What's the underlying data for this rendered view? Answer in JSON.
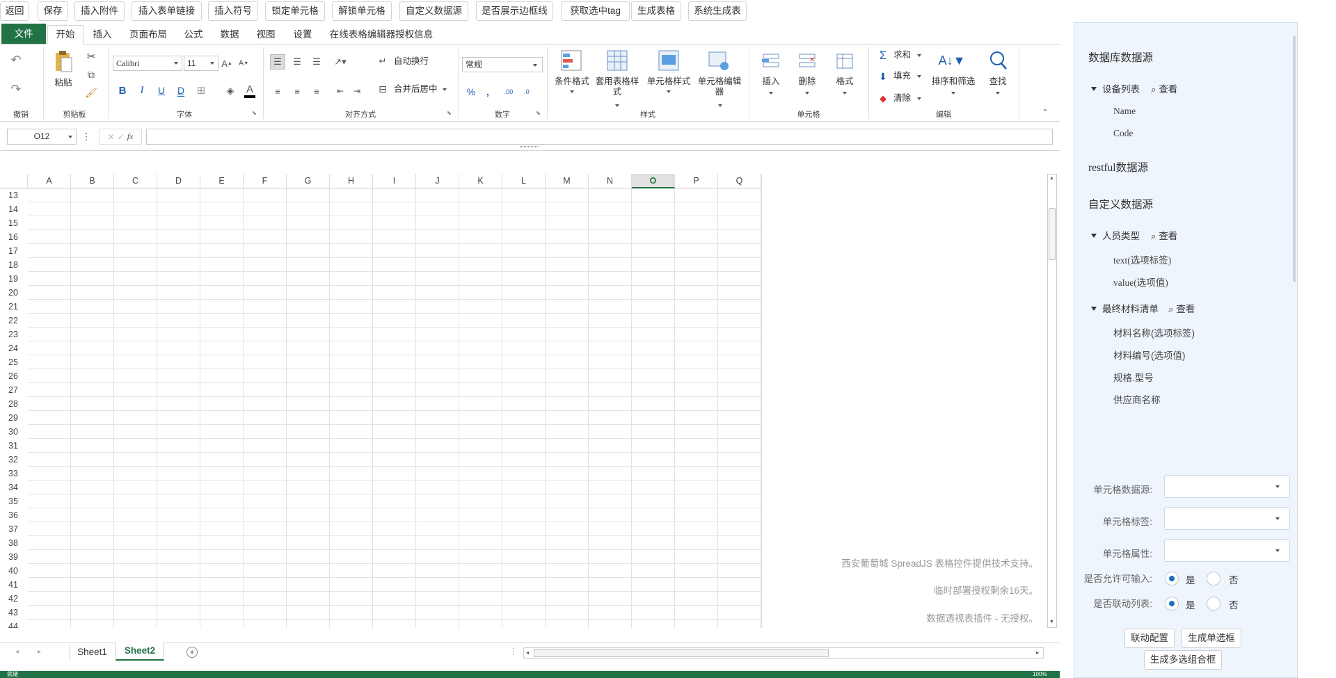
{
  "toolbar": {
    "buttons": [
      "返回",
      "保存",
      "插入附件",
      "插入表单链接",
      "插入符号",
      "锁定单元格",
      "解锁单元格",
      "自定义数据源",
      "是否展示边框线",
      "获取选中tag",
      "生成表格",
      "系统生成表"
    ]
  },
  "ribbon": {
    "tabs": [
      "文件",
      "开始",
      "插入",
      "页面布局",
      "公式",
      "数据",
      "视图",
      "设置",
      "在线表格编辑器授权信息"
    ],
    "active_tab": "开始",
    "groups": {
      "undo": "撤销",
      "clipboard": "剪贴板",
      "font": "字体",
      "alignment": "对齐方式",
      "number": "数字",
      "style": "样式",
      "cells": "单元格",
      "edit": "编辑"
    },
    "paste": "粘贴",
    "font_name": "Calibri",
    "font_size": "11",
    "wrap_text": "自动换行",
    "merge_center": "合并后居中",
    "number_format": "常规",
    "cond_format": "条件格式",
    "table_style": "套用表格样式",
    "cell_style": "单元格样式",
    "cell_editor": "单元格编辑器",
    "insert": "插入",
    "delete": "删除",
    "format": "格式",
    "sum": "求和",
    "fill": "填充",
    "clear": "清除",
    "sort_filter": "排序和筛选",
    "find": "查找"
  },
  "formula_bar": {
    "name_box": "O12",
    "formula": ""
  },
  "grid": {
    "columns": [
      "A",
      "B",
      "C",
      "D",
      "E",
      "F",
      "G",
      "H",
      "I",
      "J",
      "K",
      "L",
      "M",
      "N",
      "O",
      "P",
      "Q"
    ],
    "selected_column": "O",
    "rows": [
      "13",
      "14",
      "15",
      "16",
      "17",
      "18",
      "19",
      "20",
      "21",
      "22",
      "23",
      "24",
      "25",
      "26",
      "27",
      "28",
      "29",
      "30",
      "31",
      "32",
      "33",
      "34",
      "35",
      "36",
      "37",
      "38",
      "39",
      "40",
      "41",
      "42",
      "43",
      "44"
    ]
  },
  "watermark": {
    "line1": "西安葡萄城 SpreadJS 表格控件提供技术支持。",
    "line2": "临时部署授权剩余16天。",
    "line3": "数据透视表插件 - 无授权。"
  },
  "sheets": {
    "tabs": [
      "Sheet1",
      "Sheet2"
    ],
    "active": "Sheet2"
  },
  "status": {
    "left": "就绪",
    "zoom": "100%"
  },
  "panel": {
    "db_title": "数据库数据源",
    "db_nodes": [
      {
        "name": "设备列表",
        "view": "查看",
        "fields": [
          "Name",
          "Code"
        ]
      }
    ],
    "rest_title": "restful数据源",
    "custom_title": "自定义数据源",
    "custom_nodes": [
      {
        "name": "人员类型",
        "view": "查看",
        "fields": [
          "text(选项标签)",
          "value(选项值)"
        ]
      },
      {
        "name": "最终材料清单",
        "view": "查看",
        "fields": [
          "材料名称(选项标签)",
          "材料编号(选项值)",
          "规格.型号",
          "供应商名称"
        ]
      }
    ],
    "form": {
      "cell_datasource_label": "单元格数据源:",
      "cell_tag_label": "单元格标签:",
      "cell_attr_label": "单元格属性:",
      "allow_input_label": "是否允许可输入:",
      "linked_list_label": "是否联动列表:",
      "yes": "是",
      "no": "否",
      "allow_input_value": "是",
      "linked_list_value": "是"
    },
    "buttons": {
      "link_config": "联动配置",
      "single_select": "生成单选框",
      "multi_select": "生成多选组合框"
    }
  }
}
